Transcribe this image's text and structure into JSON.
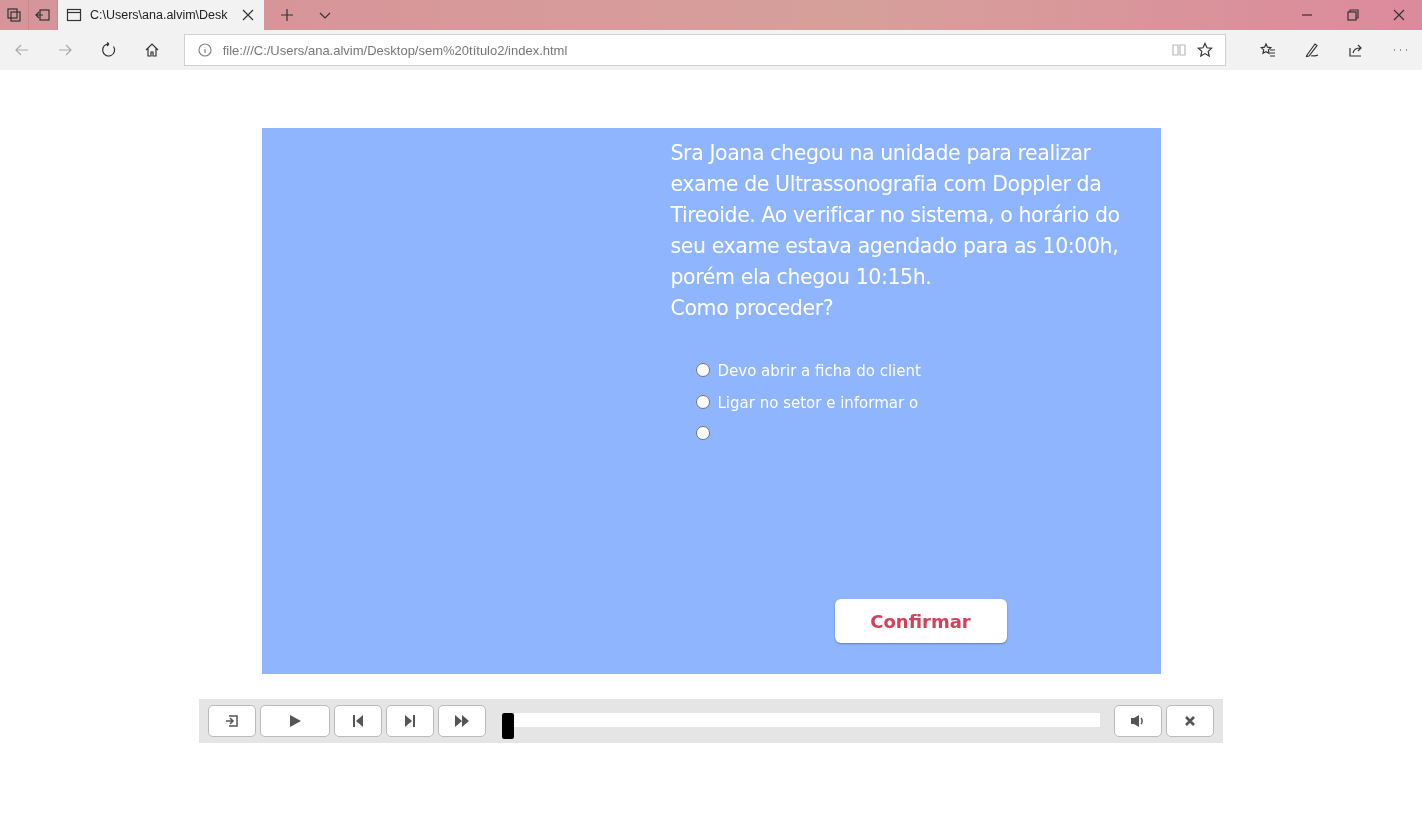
{
  "browser": {
    "tab_title": "C:\\Users\\ana.alvim\\Desk",
    "address": "file:///C:/Users/ana.alvim/Desktop/sem%20título2/index.html"
  },
  "question": {
    "text": "Sra Joana chegou na unidade para realizar exame de Ultrassonografia com Doppler da Tireoide. Ao verificar no sistema, o horário do seu exame estava agendado para as 10:00h, porém ela chegou 10:15h.",
    "prompt": "Como proceder?"
  },
  "options": [
    {
      "label": "Devo abrir a ficha do client",
      "selected": false
    },
    {
      "label": "Ligar no setor e informar o",
      "selected": false
    },
    {
      "selected": false
    }
  ],
  "confirm_button": "Confirmar",
  "player": {
    "level": 0
  }
}
